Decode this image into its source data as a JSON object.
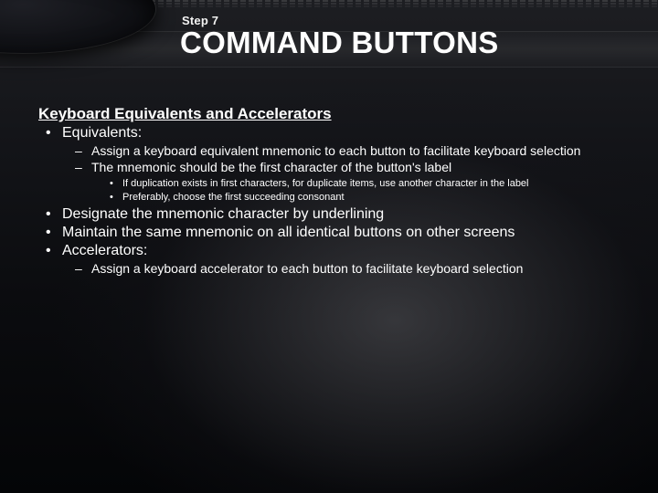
{
  "step_label": "Step 7",
  "title": "COMMAND BUTTONS",
  "heading": "Keyboard Equivalents and Accelerators",
  "b1": "Equivalents:",
  "b1_sub1": "Assign a keyboard equivalent mnemonic to each button to facilitate keyboard selection",
  "b1_sub2": "The mnemonic should be the first character of the button's label",
  "b1_sub2_a": "If duplication exists in first characters, for duplicate items, use another character in the label",
  "b1_sub2_b": "Preferably, choose the first succeeding consonant",
  "b2": "Designate the mnemonic character by underlining",
  "b3": "Maintain the same mnemonic on all identical buttons on other screens",
  "b4": "Accelerators:",
  "b4_sub1": "Assign a keyboard accelerator to each button to facilitate keyboard selection"
}
